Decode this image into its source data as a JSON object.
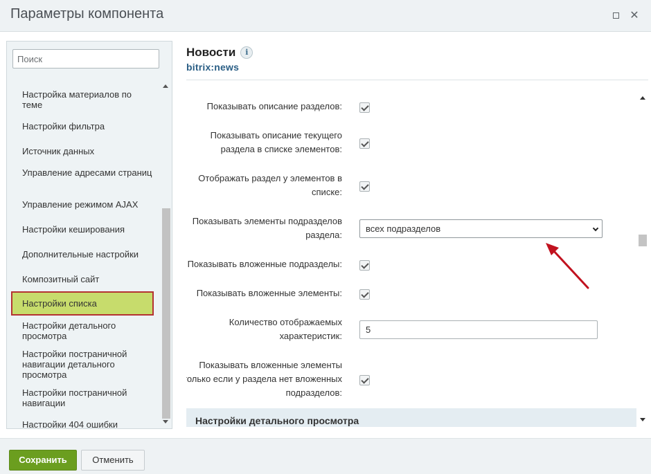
{
  "window": {
    "title": "Параметры компонента",
    "maximize_icon": "maximize-icon",
    "close_icon": "close-icon",
    "close_glyph": "✕"
  },
  "sidebar": {
    "search_placeholder": "Поиск",
    "items": [
      {
        "label": "Настройка материалов по теме"
      },
      {
        "label": "Настройки фильтра"
      },
      {
        "label": "Источник данных"
      },
      {
        "label": "Управление адресами страниц"
      },
      {
        "label": "Управление режимом AJAX"
      },
      {
        "label": "Настройки кеширования"
      },
      {
        "label": "Дополнительные настройки"
      },
      {
        "label": "Композитный сайт"
      },
      {
        "label": "Настройки списка",
        "active": true
      },
      {
        "label": "Настройки детального просмотра"
      },
      {
        "label": "Настройки постраничной навигации детального просмотра"
      },
      {
        "label": "Настройки постраничной навигации"
      },
      {
        "label": "Настройки 404 ошибки"
      }
    ]
  },
  "content": {
    "title": "Новости",
    "info_glyph": "i",
    "subtitle": "bitrix:news",
    "fields": {
      "show_section_desc": "Показывать описание разделов:",
      "show_current_section_desc": "Показывать описание текущего раздела в списке элементов:",
      "show_section_in_elements": "Отображать раздел у элементов в списке:",
      "show_subsection_elements": "Показывать элементы подразделов раздела:",
      "show_subsection_elements_value": "всех подразделов",
      "show_nested_sections": "Показывать вложенные подразделы:",
      "show_nested_elements": "Показывать вложенные элементы:",
      "properties_count": "Количество отображаемых характеристик:",
      "properties_count_value": "5",
      "show_nested_only_if_no_sub": "Показывать вложенные элементы только если у раздела нет вложенных подразделов:"
    },
    "section_band": "Настройки детального просмотра"
  },
  "footer": {
    "save_label": "Сохранить",
    "cancel_label": "Отменить"
  },
  "colors": {
    "accent_green": "#6b9e1f",
    "active_item_bg": "#c7dc6c",
    "active_item_border": "#b43232",
    "annotation_arrow": "#c1121f",
    "link_blue": "#2a5e85"
  }
}
